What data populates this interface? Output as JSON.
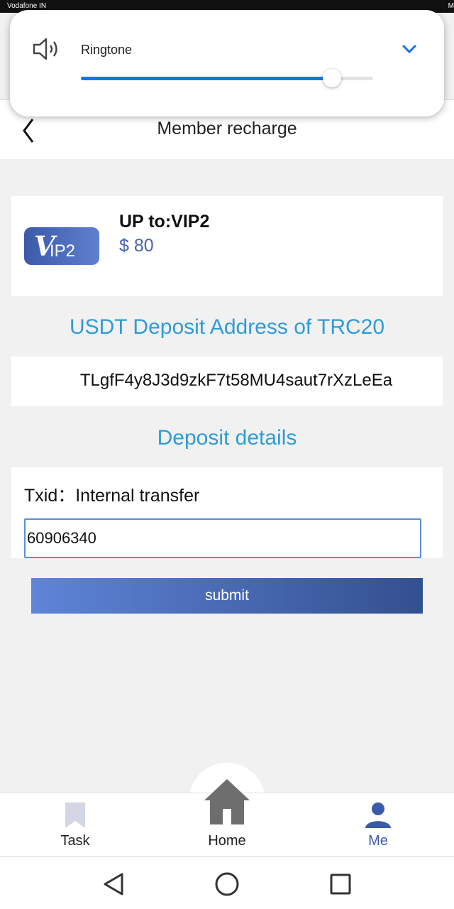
{
  "status_bar": {
    "carrier": "Vodafone IN",
    "time": "M"
  },
  "header": {
    "title": "Member recharge"
  },
  "volume_panel": {
    "label": "Ringtone",
    "level": 0.86
  },
  "vip_card": {
    "badge_v": "V",
    "badge_rest": "IP2",
    "upgrade_text": "UP to:VIP2",
    "price": "$ 80"
  },
  "deposit_address": {
    "title": "USDT Deposit Address of TRC20",
    "address": "TLgfF4y8J3d9zkF7t58MU4saut7rXzLeEa"
  },
  "deposit_details": {
    "title": "Deposit details",
    "txid_label": "Txid：Internal transfer",
    "txid_value": "60906340"
  },
  "submit": {
    "label": "submit"
  },
  "bottom_nav": {
    "items": [
      {
        "label": "Task",
        "icon": "bookmark-icon"
      },
      {
        "label": "Home",
        "icon": "home-icon"
      },
      {
        "label": "Me",
        "icon": "person-icon"
      }
    ],
    "active_color": "#3a5ba9"
  },
  "system_nav": {
    "icons": [
      "back-triangle-icon",
      "home-circle-icon",
      "recents-square-icon"
    ]
  },
  "colors": {
    "accent": "#2d9cd8",
    "slider": "#1a73e8",
    "button_start": "#5f84d8",
    "button_end": "#33508f"
  }
}
